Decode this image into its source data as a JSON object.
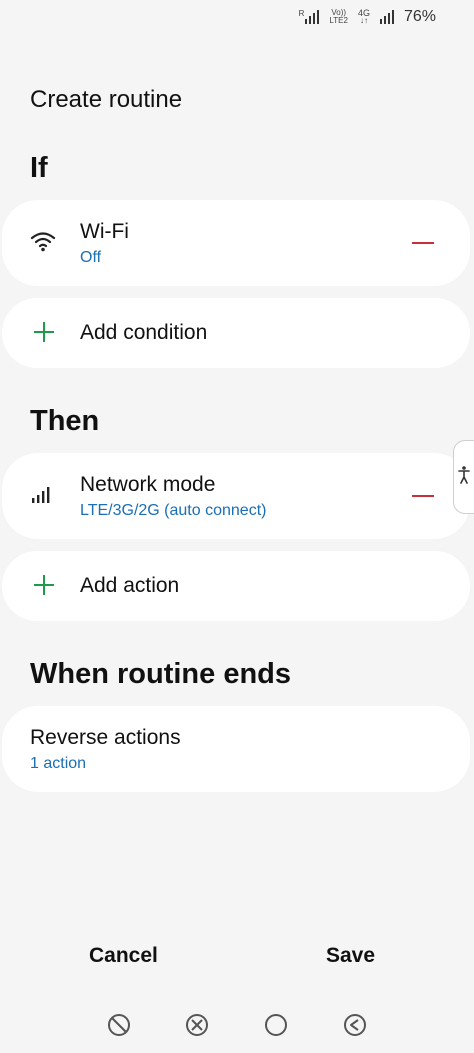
{
  "status_bar": {
    "sim_label": "R",
    "volte_top": "Vo))",
    "volte_bottom": "LTE2",
    "network_type": "4G",
    "battery": "76%"
  },
  "page": {
    "title": "Create routine"
  },
  "if_section": {
    "title": "If",
    "condition": {
      "icon": "wifi-icon",
      "name": "Wi-Fi",
      "value": "Off"
    },
    "add_label": "Add condition"
  },
  "then_section": {
    "title": "Then",
    "action": {
      "icon": "signal-bars-icon",
      "name": "Network mode",
      "value": "LTE/3G/2G (auto connect)"
    },
    "add_label": "Add action"
  },
  "ends_section": {
    "title": "When routine ends",
    "reverse": {
      "name": "Reverse actions",
      "value": "1 action"
    }
  },
  "footer": {
    "cancel_label": "Cancel",
    "save_label": "Save"
  },
  "navigation": {
    "items": [
      "blocked-circle-icon",
      "cancel-circle-icon",
      "home-circle-icon",
      "back-circle-icon"
    ]
  },
  "colors": {
    "accent_blue": "#1a6fb5",
    "add_green": "#1e9a4a",
    "remove_red": "#c8303a",
    "background": "#f5f5f5",
    "card": "#ffffff"
  }
}
